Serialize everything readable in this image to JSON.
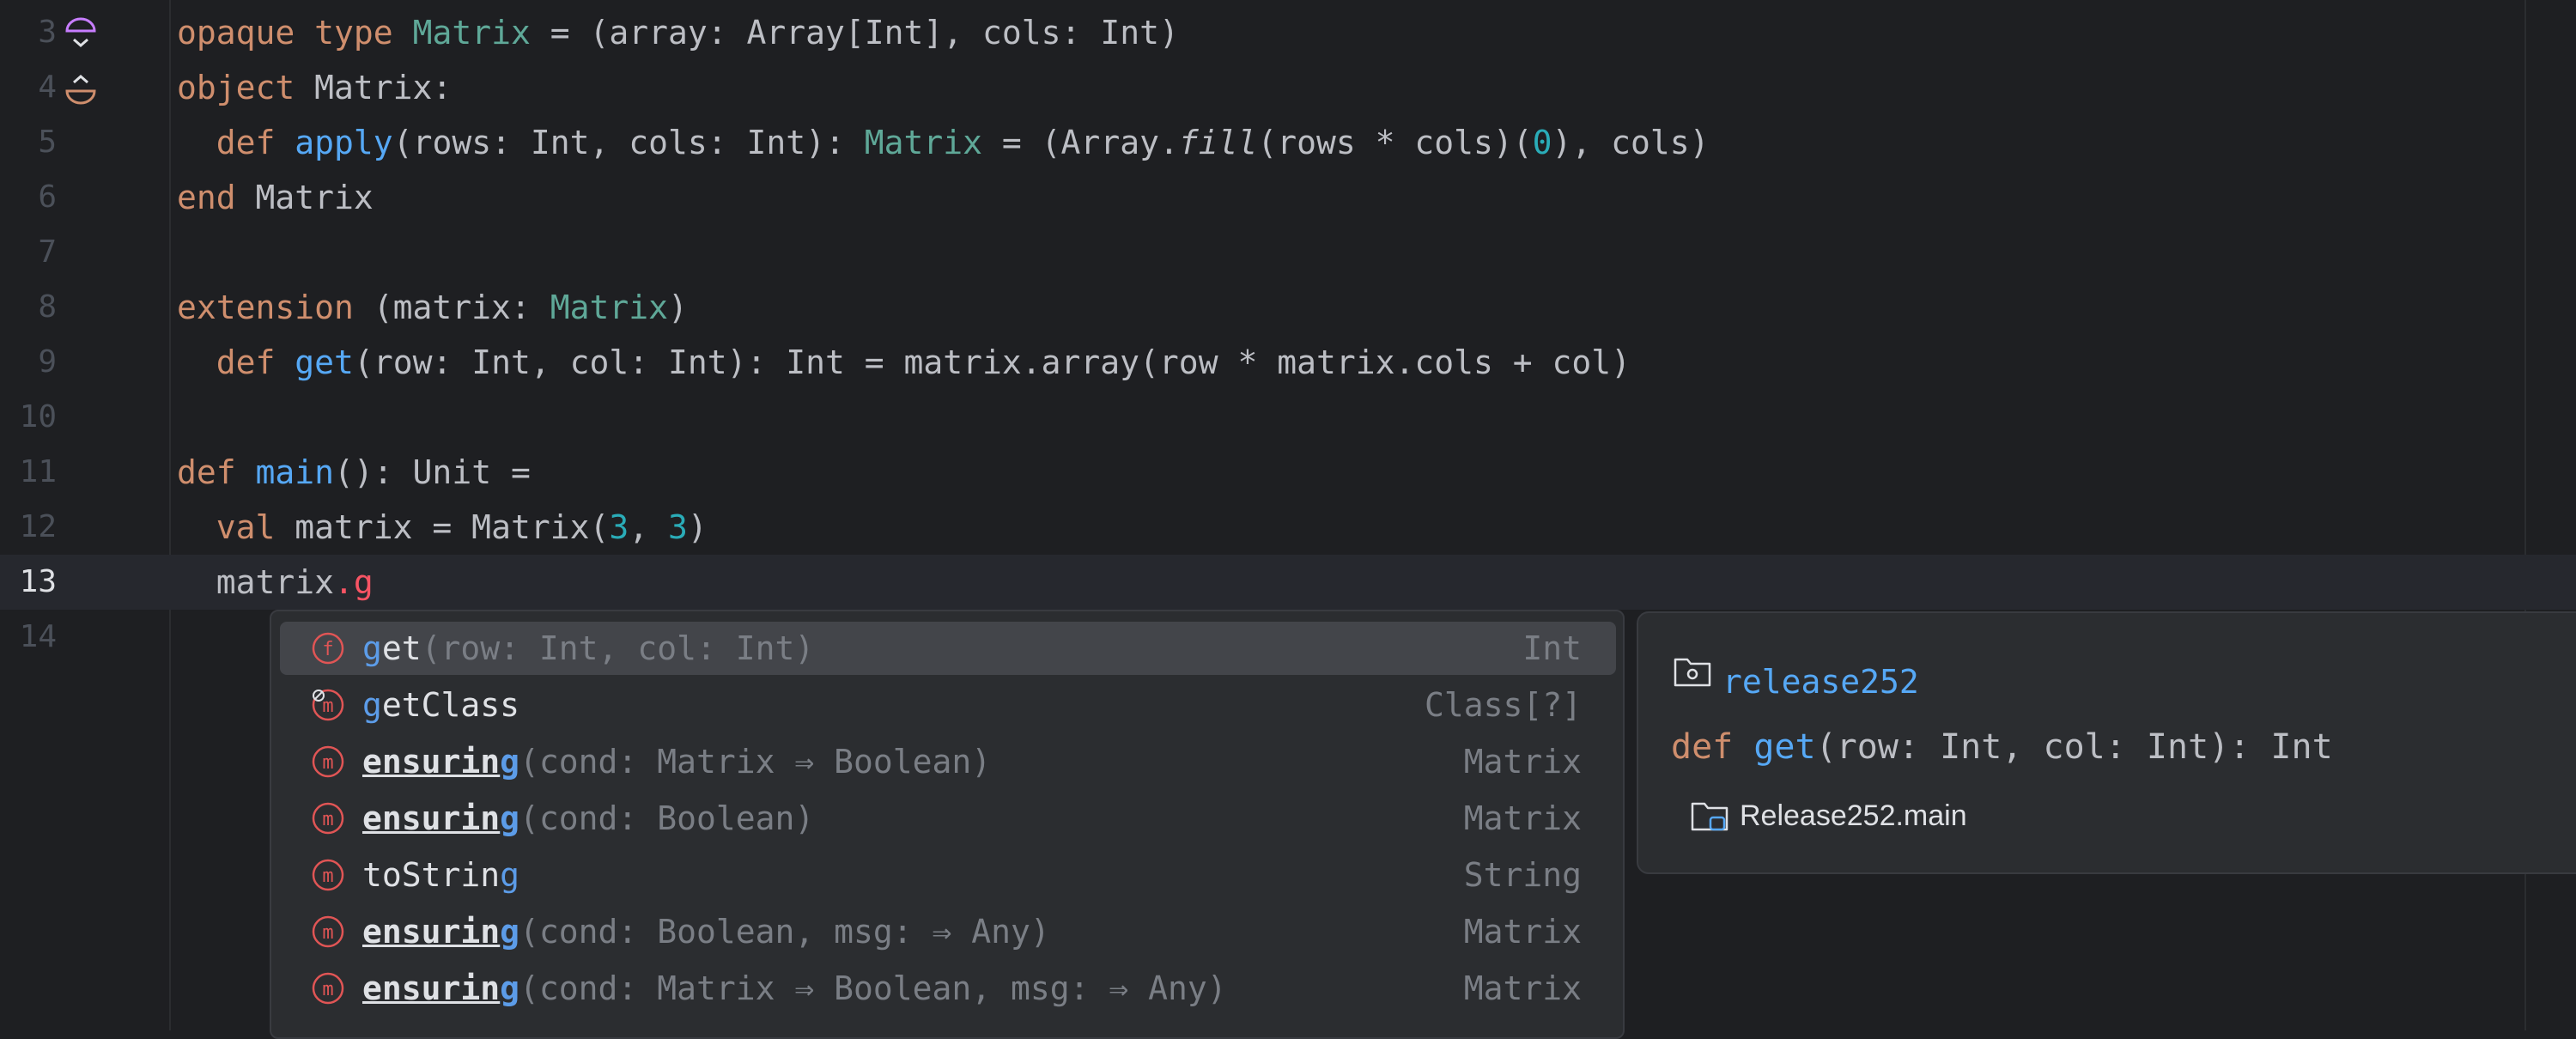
{
  "editor": {
    "lines": [
      {
        "num": "3"
      },
      {
        "num": "4"
      },
      {
        "num": "5"
      },
      {
        "num": "6"
      },
      {
        "num": "7"
      },
      {
        "num": "8"
      },
      {
        "num": "9"
      },
      {
        "num": "10"
      },
      {
        "num": "11"
      },
      {
        "num": "12"
      },
      {
        "num": "13"
      },
      {
        "num": "14"
      }
    ],
    "code": {
      "l3": {
        "opaque": "opaque",
        "type": "type",
        "name": "Matrix",
        "rest": " = (array: Array[Int], cols: Int)"
      },
      "l4": {
        "object": "object",
        "rest": " Matrix:"
      },
      "l5": {
        "def": "def",
        "apply": "apply",
        "a": "(rows: Int, cols: Int): ",
        "matrix": "Matrix",
        "b": " = (Array.",
        "fill": "fill",
        "c": "(rows * cols)(",
        "zero": "0",
        "d": "), cols)"
      },
      "l6": {
        "end": "end",
        "rest": " Matrix"
      },
      "l8": {
        "extension": "extension",
        "a": " (matrix: ",
        "matrix": "Matrix",
        "b": ")"
      },
      "l9": {
        "def": "def",
        "get": "get",
        "rest": "(row: Int, col: Int): Int = matrix.array(row * matrix.cols + col)"
      },
      "l11": {
        "def": "def",
        "main": "main",
        "rest": "(): Unit ="
      },
      "l12": {
        "val": "val",
        "a": " matrix = Matrix(",
        "n1": "3",
        "sep": ", ",
        "n2": "3",
        "b": ")"
      },
      "l13": {
        "a": "matrix",
        "typed": ".g"
      }
    }
  },
  "completion": {
    "items": [
      {
        "icon": "f",
        "match": "g",
        "rest": "et",
        "params": "(row: Int, col: Int)",
        "type": "Int"
      },
      {
        "icon": "m",
        "match": "g",
        "rest": "etClass",
        "params": "",
        "type": "Class[?]"
      },
      {
        "icon": "m",
        "match": "",
        "rest": "ensurin",
        "last": "g",
        "params": "(cond: Matrix ⇒ Boolean)",
        "type": "Matrix"
      },
      {
        "icon": "m",
        "match": "",
        "rest": "ensurin",
        "last": "g",
        "params": "(cond: Boolean)",
        "type": "Matrix"
      },
      {
        "icon": "m",
        "match": "",
        "rest": "toStrin",
        "last": "g",
        "params": "",
        "type": "String"
      },
      {
        "icon": "m",
        "match": "",
        "rest": "ensurin",
        "last": "g",
        "params": "(cond: Boolean, msg: ⇒ Any)",
        "type": "Matrix"
      },
      {
        "icon": "m",
        "match": "",
        "rest": "ensurin",
        "last": "g",
        "params": "(cond: Matrix ⇒ Boolean, msg: ⇒ Any)",
        "type": "Matrix"
      }
    ]
  },
  "documentation": {
    "module": "release252",
    "sig_def": "def",
    "sig_name": "get",
    "sig_rest": "(row: Int, col: Int): Int",
    "package": "Release252.main"
  },
  "colors": {
    "background": "#1e1f22",
    "keyword": "#cf8e6d",
    "function": "#56a8f5",
    "number": "#2aacb8",
    "method_icon": "#e05555"
  }
}
